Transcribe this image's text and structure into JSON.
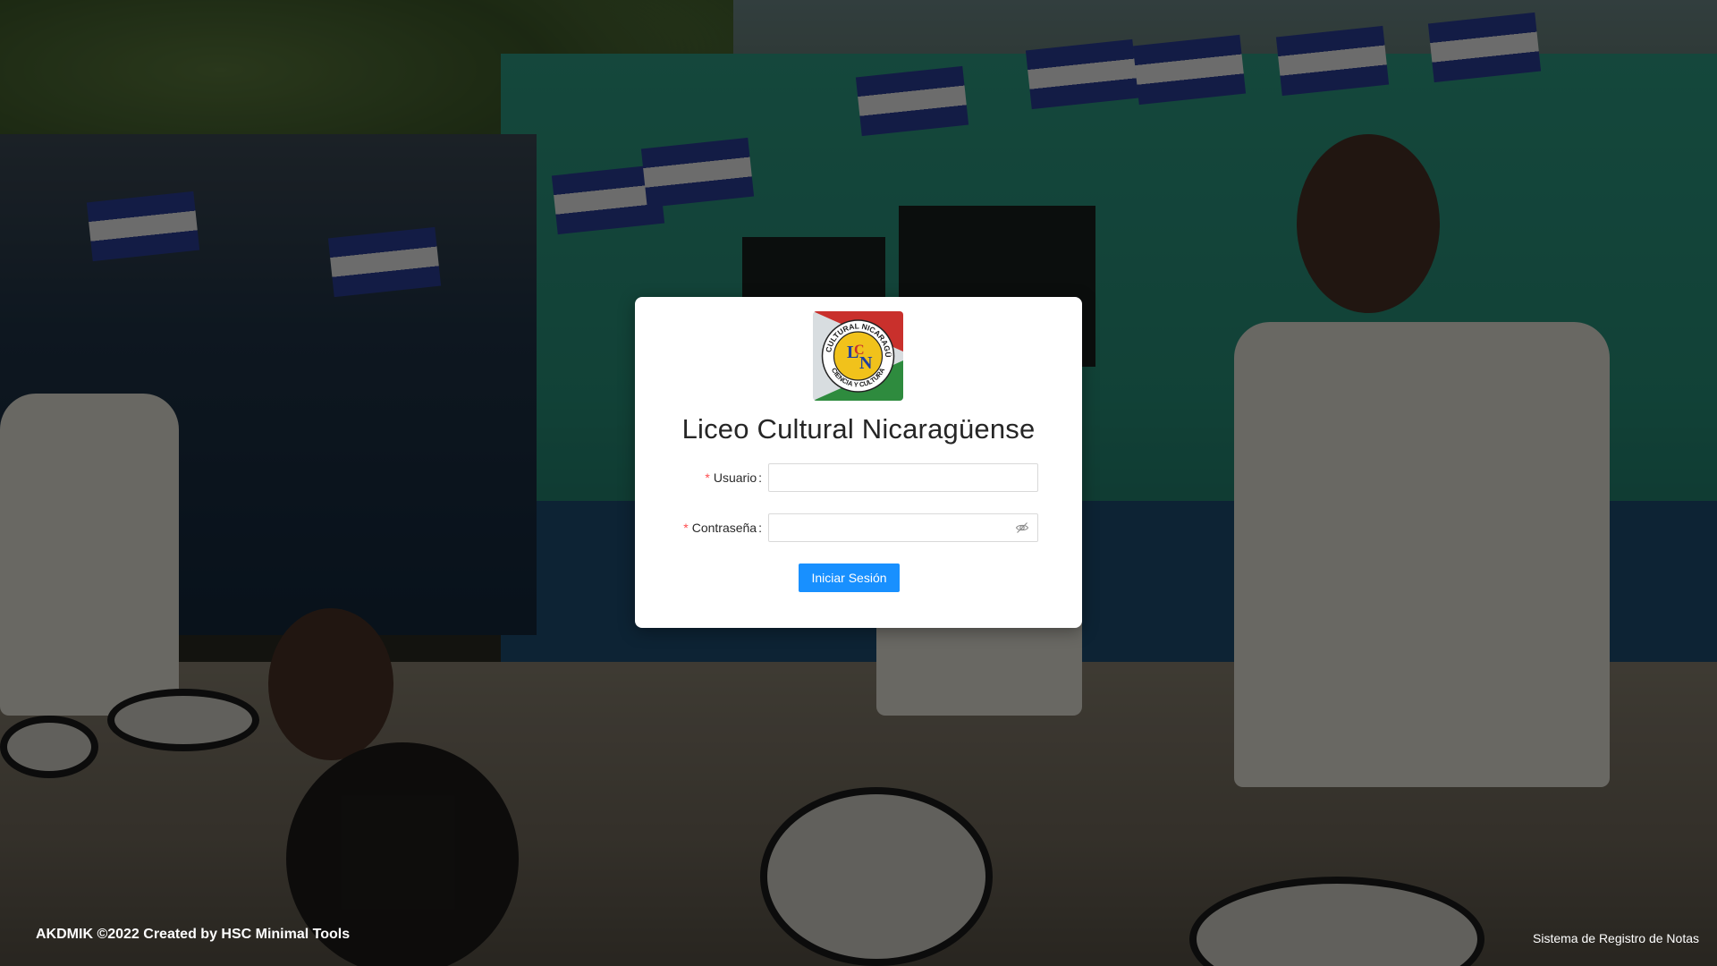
{
  "background": {
    "description_icon": "photo-background",
    "overlay_color": "#000000"
  },
  "login": {
    "logo": {
      "icon": "school-logo",
      "text_arc": "LICEO CULTURAL NICARAGÜENSE",
      "text_bottom": "CIENCIA Y CULTURA",
      "monogram_l": "L",
      "monogram_c": "C",
      "monogram_n": "N"
    },
    "title": "Liceo Cultural Nicaragüense",
    "fields": {
      "username": {
        "required_mark": "*",
        "label": "Usuario",
        "colon": ":",
        "value": "",
        "placeholder": ""
      },
      "password": {
        "required_mark": "*",
        "label": "Contraseña",
        "colon": ":",
        "value": "",
        "placeholder": "",
        "toggle_icon": "eye-invisible-icon"
      }
    },
    "submit_label": "Iniciar Sesión",
    "accent_color": "#1890ff"
  },
  "footer": {
    "left_text": "AKDMIK ©2022 Created by HSC Minimal Tools",
    "right_text": "Sistema de Registro de Notas"
  }
}
